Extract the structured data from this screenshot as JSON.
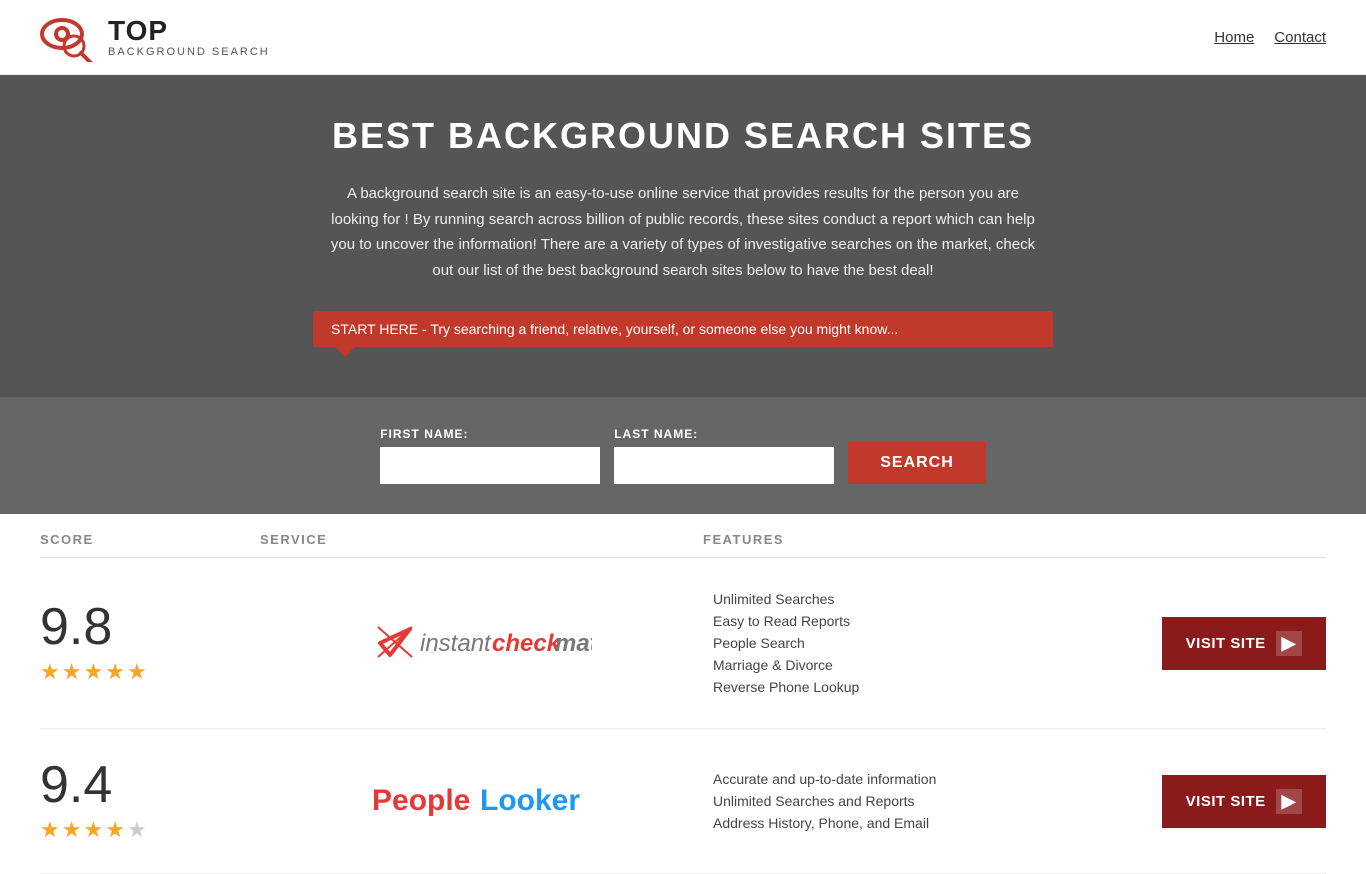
{
  "header": {
    "logo_top": "TOP",
    "logo_bottom": "BACKGROUND SEARCH",
    "nav": [
      {
        "label": "Home",
        "href": "#"
      },
      {
        "label": "Contact",
        "href": "#"
      }
    ]
  },
  "hero": {
    "title": "BEST BACKGROUND SEARCH SITES",
    "description": "A background search site is an easy-to-use online service that provides results  for the person you are looking for ! By  running  search across billion of public records, these sites conduct  a report which can help you to uncover the information! There are a variety of types of investigative searches on the market, check out our  list of the best background search sites below to have the best deal!",
    "callout": "START HERE - Try searching a friend, relative, yourself, or someone else you might know...",
    "form": {
      "first_name_label": "FIRST NAME:",
      "last_name_label": "LAST NAME:",
      "search_button": "SEARCH"
    }
  },
  "table": {
    "columns": [
      {
        "label": "SCORE"
      },
      {
        "label": "SERVICE"
      },
      {
        "label": "FEATURES"
      },
      {
        "label": ""
      }
    ],
    "rows": [
      {
        "score": "9.8",
        "stars": 4.5,
        "service_name": "Instant Checkmate",
        "features": [
          "Unlimited Searches",
          "Easy to Read Reports",
          "People Search",
          "Marriage & Divorce",
          "Reverse Phone Lookup"
        ],
        "visit_label": "VISIT SITE"
      },
      {
        "score": "9.4",
        "stars": 4,
        "service_name": "PeopleLooker",
        "features": [
          "Accurate and up-to-date information",
          "Unlimited Searches and Reports",
          "Address History, Phone, and Email"
        ],
        "visit_label": "VISIT SITE"
      }
    ]
  }
}
